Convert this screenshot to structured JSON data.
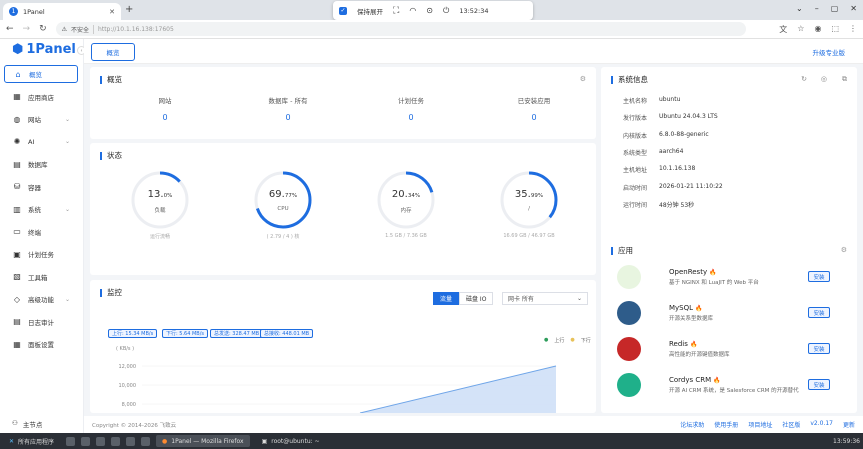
{
  "browser": {
    "tab_title": "1Panel",
    "url_security": "不安全",
    "url": "http://10.1.16.138:17605"
  },
  "screenshot_tool": {
    "keep_label": "保持展开",
    "time": "13:52:34"
  },
  "sidebar": {
    "logo": "1Panel",
    "items": [
      {
        "label": "概览",
        "icon": "home-icon",
        "active": true
      },
      {
        "label": "应用商店",
        "icon": "grid-icon",
        "active": false
      },
      {
        "label": "网站",
        "icon": "globe-icon",
        "active": false,
        "chevron": true
      },
      {
        "label": "AI",
        "icon": "ai-icon",
        "active": false,
        "chevron": true
      },
      {
        "label": "数据库",
        "icon": "database-icon",
        "active": false
      },
      {
        "label": "容器",
        "icon": "container-icon",
        "active": false
      },
      {
        "label": "系统",
        "icon": "system-icon",
        "active": false,
        "chevron": true
      },
      {
        "label": "终端",
        "icon": "terminal-icon",
        "active": false
      },
      {
        "label": "计划任务",
        "icon": "calendar-icon",
        "active": false
      },
      {
        "label": "工具箱",
        "icon": "toolbox-icon",
        "active": false
      },
      {
        "label": "高级功能",
        "icon": "diamond-icon",
        "active": false,
        "chevron": true
      },
      {
        "label": "日志审计",
        "icon": "log-icon",
        "active": false
      },
      {
        "label": "面板设置",
        "icon": "settings-icon",
        "active": false
      }
    ],
    "footer": "主节点"
  },
  "topbar": {
    "tab": "概览",
    "upgrade": "升级专业版"
  },
  "overview": {
    "title": "概览",
    "stats": [
      {
        "label": "网站",
        "value": "0"
      },
      {
        "label": "数据库 - 所有",
        "value": "0"
      },
      {
        "label": "计划任务",
        "value": "0"
      },
      {
        "label": "已安装应用",
        "value": "0"
      }
    ]
  },
  "status": {
    "title": "状态",
    "gauges": [
      {
        "int": "13.",
        "dec": "0",
        "unit": "%",
        "label": "负载",
        "caption": "运行流畅",
        "percent": 13.0
      },
      {
        "int": "69.",
        "dec": "77",
        "unit": "%",
        "label": "CPU",
        "caption": "( 2.79 / 4 ) 核",
        "percent": 69.77
      },
      {
        "int": "20.",
        "dec": "34",
        "unit": "%",
        "label": "内存",
        "caption": "1.5 GB / 7.36 GB",
        "percent": 20.34
      },
      {
        "int": "35.",
        "dec": "99",
        "unit": "%",
        "label": "/",
        "caption": "16.69 GB / 46.97 GB",
        "percent": 35.99
      }
    ]
  },
  "monitor": {
    "title": "监控",
    "btn_traffic": "流量",
    "btn_disk": "磁盘 IO",
    "select": "网卡  所有",
    "tags": [
      "上行: 15.34 MB/s",
      "下行: 5.64 MB/s",
      "总发送: 328.47 MB",
      "总接收: 448.01 MB"
    ],
    "legend_up": "上行",
    "legend_down": "下行",
    "unit": "( KB/s )",
    "yticks": [
      "12,000",
      "10,000",
      "8,000",
      "6,000"
    ]
  },
  "sysinfo": {
    "title": "系统信息",
    "rows": [
      {
        "k": "主机名称",
        "v": "ubuntu"
      },
      {
        "k": "发行版本",
        "v": "Ubuntu 24.04.3 LTS"
      },
      {
        "k": "内核版本",
        "v": "6.8.0-88-generic"
      },
      {
        "k": "系统类型",
        "v": "aarch64"
      },
      {
        "k": "主机地址",
        "v": "10.1.16.138"
      },
      {
        "k": "启动时间",
        "v": "2026-01-21 11:10:22"
      },
      {
        "k": "运行时间",
        "v": "48分钟 53秒"
      }
    ]
  },
  "apps": {
    "title": "应用",
    "install_label": "安装",
    "items": [
      {
        "name": "OpenResty",
        "desc": "基于 NGINX 和 LuaJIT 的 Web 平台",
        "color": "#e8f5e0"
      },
      {
        "name": "MySQL",
        "desc": "开源关系型数据库",
        "color": "#2e5c8a"
      },
      {
        "name": "Redis",
        "desc": "高性能的开源键值数据库",
        "color": "#c62828"
      },
      {
        "name": "Cordys CRM",
        "desc": "开源 AI CRM 系统，是 Salesforce CRM 的开源替代",
        "color": "#1fb08a"
      }
    ]
  },
  "footer": {
    "copyright": "Copyright © 2014-2026 飞致云",
    "links": [
      "论坛求助",
      "使用手册",
      "项目地址",
      "社区版",
      "v2.0.17",
      "更新"
    ]
  },
  "taskbar": {
    "start": "所有应用程序",
    "firefox": "1Panel — Mozilla Firefox",
    "terminal": "root@ubuntu: ~",
    "clock": "13:59:36"
  }
}
